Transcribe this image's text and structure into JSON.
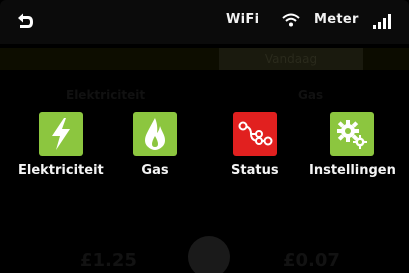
{
  "statusbar": {
    "back_icon": "back-arrow-icon",
    "wifi_label": "WiFi",
    "wifi_icon": "wifi-icon",
    "meter_label": "Meter",
    "signal_icon": "signal-bars-icon"
  },
  "tabs": {
    "right_label": "Vandaag"
  },
  "background_labels": {
    "left": "Elektriciteit",
    "right": "Gas"
  },
  "menu": {
    "items": [
      {
        "label": "Elektriciteit",
        "icon": "lightning-bolt-icon",
        "color": "#8cc63f"
      },
      {
        "label": "Gas",
        "icon": "flame-icon",
        "color": "#8cc63f"
      },
      {
        "label": "Status",
        "icon": "network-nodes-icon",
        "color": "#e1201f"
      },
      {
        "label": "Instellingen",
        "icon": "gears-icon",
        "color": "#8cc63f"
      }
    ]
  },
  "amounts": {
    "left": "£1.25",
    "right": "£0.07"
  }
}
